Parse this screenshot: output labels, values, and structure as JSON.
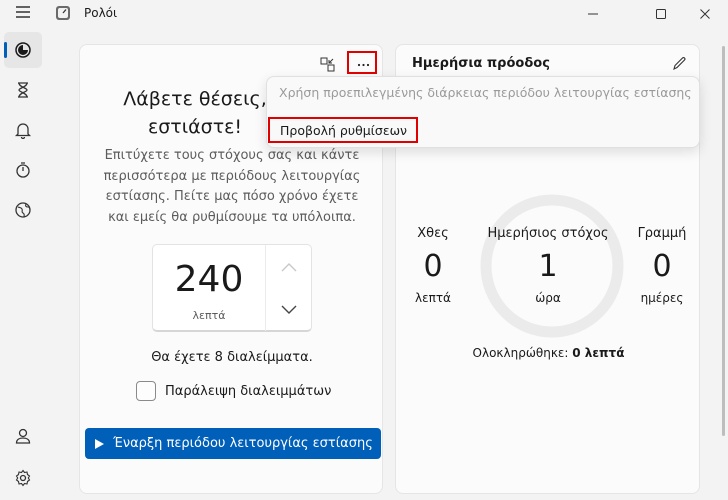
{
  "app": {
    "title": "Ρολόι"
  },
  "rail": {
    "items": [
      {
        "name": "menu-icon"
      },
      {
        "name": "focus-icon",
        "active": true
      },
      {
        "name": "hourglass-icon"
      },
      {
        "name": "bell-icon"
      },
      {
        "name": "stopwatch-icon"
      },
      {
        "name": "globe-icon"
      },
      {
        "name": "account-icon"
      },
      {
        "name": "settings-icon"
      }
    ]
  },
  "focus": {
    "title": "Λάβετε θέσεις, εστιάστε!",
    "description": "Επιτύχετε τους στόχους σας και κάντε περισσότερα με περιόδους λειτουργίας εστίασης. Πείτε μας πόσο χρόνο έχετε και εμείς θα ρυθμίσουμε τα υπόλοιπα.",
    "timer_value": "240",
    "timer_unit": "λεπτά",
    "breaks_text": "Θα έχετε 8 διαλείμματα.",
    "skip_breaks_label": "Παράλειψη διαλειμμάτων",
    "skip_breaks_checked": false,
    "start_button": "Έναρξη περιόδου λειτουργίας εστίασης"
  },
  "progress": {
    "title": "Ημερήσια πρόοδος",
    "yesterday": {
      "label": "Χθες",
      "value": "0",
      "unit": "λεπτά"
    },
    "goal": {
      "label": "Ημερήσιος στόχος",
      "value": "1",
      "unit": "ώρα"
    },
    "streak": {
      "label": "Γραμμή",
      "value": "0",
      "unit": "ημέρες"
    },
    "completed_label": "Ολοκληρώθηκε:",
    "completed_value": "0 λεπτά"
  },
  "menu": {
    "disabled_item": "Χρήση προεπιλεγμένης διάρκειας περιόδου λειτουργίας εστίασης",
    "settings_item": "Προβολή ρυθμίσεων"
  },
  "colors": {
    "accent": "#005fb8",
    "highlight": "#e00000"
  }
}
